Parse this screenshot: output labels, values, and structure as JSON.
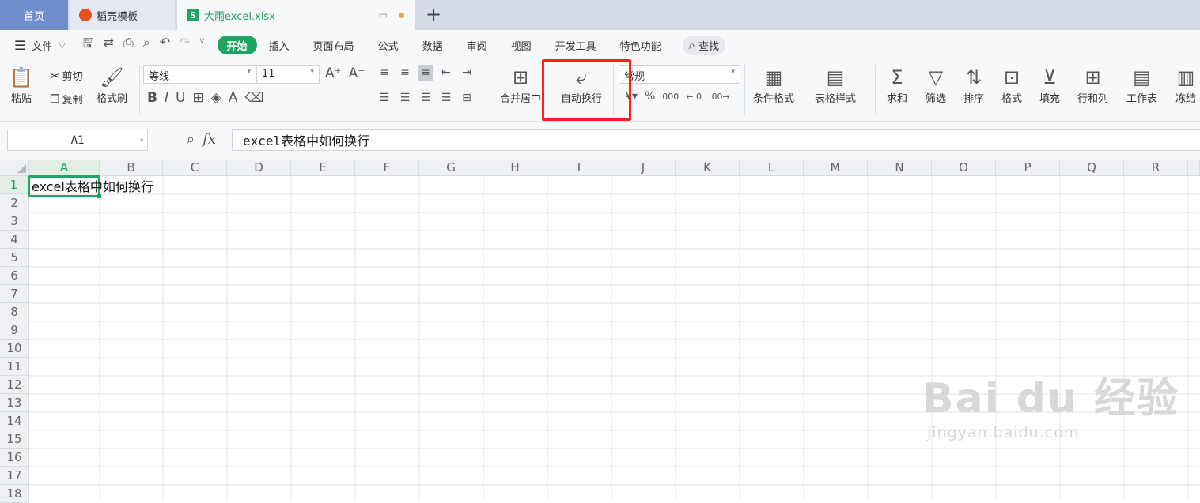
{
  "tabs": {
    "home": "首页",
    "template": "稻壳模板",
    "file": "大雨excel.xlsx",
    "template_icon_letter": "",
    "file_icon_letter": "S"
  },
  "menu": {
    "file_label": "文件",
    "items": [
      "开始",
      "插入",
      "页面布局",
      "公式",
      "数据",
      "审阅",
      "视图",
      "开发工具",
      "特色功能"
    ],
    "search_label": "查找"
  },
  "ribbon": {
    "paste": "粘贴",
    "cut": "剪切",
    "copy": "复制",
    "format_painter": "格式刷",
    "font_name": "等线",
    "font_size": "11",
    "merge_center": "合并居中",
    "wrap_text": "自动换行",
    "number_format": "常规",
    "cond_format": "条件格式",
    "table_style": "表格样式",
    "sum": "求和",
    "filter": "筛选",
    "sort": "排序",
    "format": "格式",
    "fill": "填充",
    "row_col": "行和列",
    "worksheet": "工作表",
    "freeze": "冻结"
  },
  "formula": {
    "name_box": "A1",
    "fx_label": "fx",
    "content": "excel表格中如何换行"
  },
  "sheet": {
    "columns": [
      "A",
      "B",
      "C",
      "D",
      "E",
      "F",
      "G",
      "H",
      "I",
      "J",
      "K",
      "L",
      "M",
      "N",
      "O",
      "P",
      "Q",
      "R"
    ],
    "rows": [
      "1",
      "2",
      "3",
      "4",
      "5",
      "6",
      "7",
      "8",
      "9",
      "10",
      "11",
      "12",
      "13",
      "14",
      "15",
      "16",
      "17",
      "18"
    ],
    "selected_cell": "A1",
    "a1_value": "excel表格中如何换行"
  },
  "watermark": {
    "main": "Bai du 经验",
    "sub": "jingyan.baidu.com"
  },
  "colors": {
    "accent": "#1fa462",
    "highlight": "#ff1f1f"
  }
}
